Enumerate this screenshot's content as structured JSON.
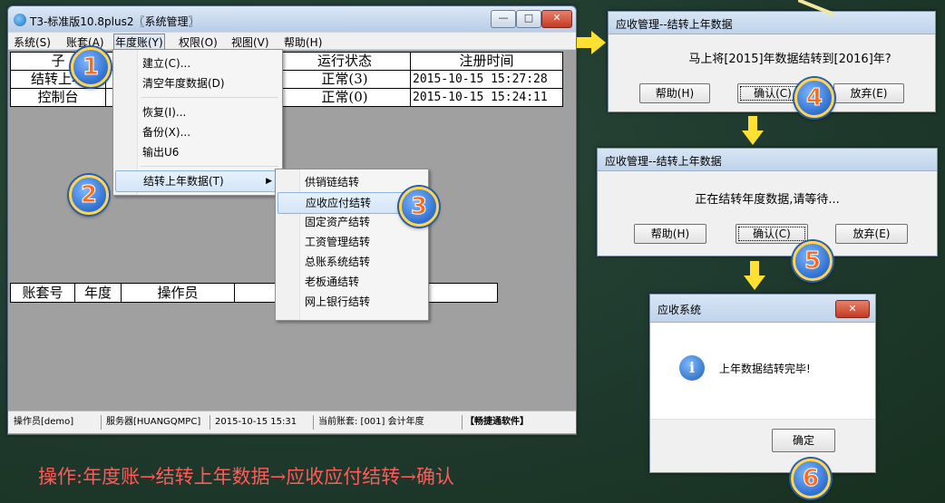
{
  "window": {
    "title": "T3-标准版10.8plus2〖系统管理〗",
    "min_glyph": "—",
    "max_glyph": "□",
    "close_glyph": "✕"
  },
  "menubar": [
    "系统(S)",
    "账套(A)",
    "年度账(Y)",
    "权限(O)",
    "视图(V)",
    "帮助(H)"
  ],
  "upper_table": {
    "headers": [
      "子",
      "",
      "运行状态",
      "注册时间"
    ],
    "rows": [
      [
        "结转上年",
        "",
        "正常(3)",
        "2015-10-15 15:27:28"
      ],
      [
        "控制台",
        "",
        "正常(0)",
        "2015-10-15 15:24:11"
      ]
    ]
  },
  "lower_table": {
    "headers": [
      "账套号",
      "年度",
      "操作员",
      ""
    ]
  },
  "year_menu": {
    "items": [
      "建立(C)...",
      "清空年度数据(D)",
      "恢复(I)...",
      "备份(X)...",
      "输出U6",
      "结转上年数据(T)"
    ],
    "submenu_arrow": "▶"
  },
  "carry_submenu": {
    "items": [
      "供销链结转",
      "应收应付结转",
      "固定资产结转",
      "工资管理结转",
      "总账系统结转",
      "老板通结转",
      "网上银行结转"
    ]
  },
  "statusbar": {
    "operator": "操作员[demo]",
    "server": "服务器[HUANGQMPC]",
    "datetime": "2015-10-15 15:31",
    "account": "当前账套: [001] 会计年度",
    "vendor": "【畅捷通软件】"
  },
  "dialog1": {
    "title": "应收管理--结转上年数据",
    "message": "马上将[2015]年数据结转到[2016]年?",
    "help": "帮助(H)",
    "ok": "确认(C)",
    "cancel": "放弃(E)"
  },
  "dialog2": {
    "title": "应收管理--结转上年数据",
    "message": "正在结转年度数据,请等待...",
    "help": "帮助(H)",
    "ok": "确认(C)",
    "cancel": "放弃(E)"
  },
  "dialog3": {
    "title": "应收系统",
    "close_glyph": "✕",
    "info_glyph": "i",
    "message": "上年数据结转完毕!",
    "ok": "确定"
  },
  "steps": [
    "1",
    "2",
    "3",
    "4",
    "5",
    "6"
  ],
  "caption": "操作:年度账→结转上年数据→应收应付结转→确认",
  "colors": {
    "background": "#1f3a2e",
    "arrow": "#ffe033",
    "caption": "#ff5a5a",
    "badge_number": "#ff6a1a"
  }
}
